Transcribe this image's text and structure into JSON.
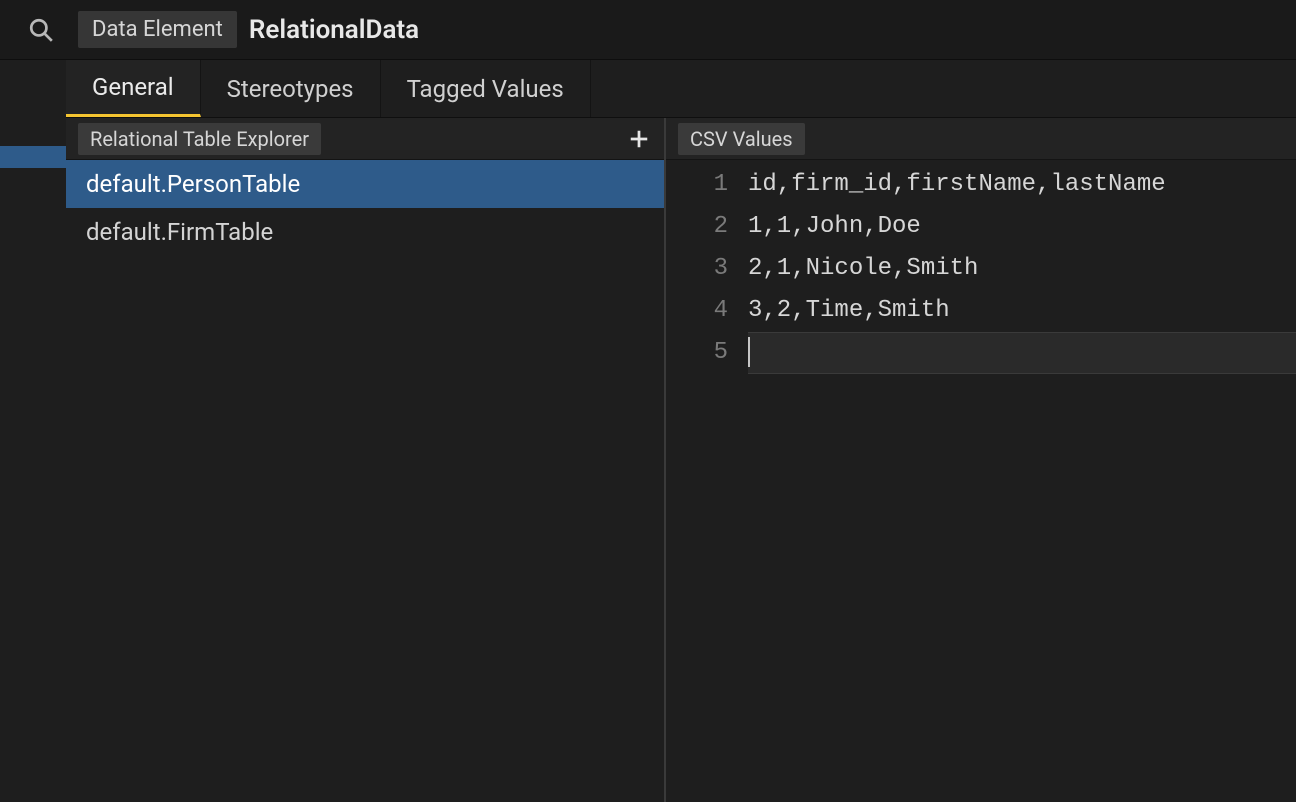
{
  "header": {
    "chip_label": "Data Element",
    "title": "RelationalData"
  },
  "tabs": [
    {
      "label": "General",
      "active": true
    },
    {
      "label": "Stereotypes",
      "active": false
    },
    {
      "label": "Tagged Values",
      "active": false
    }
  ],
  "explorer": {
    "header_label": "Relational Table Explorer",
    "items": [
      {
        "label": "default.PersonTable",
        "selected": true
      },
      {
        "label": "default.FirmTable",
        "selected": false
      }
    ]
  },
  "csv_panel": {
    "header_label": "CSV Values",
    "lines": [
      "id,firm_id,firstName,lastName",
      "1,1,John,Doe",
      "2,1,Nicole,Smith",
      "3,2,Time,Smith",
      ""
    ]
  },
  "icons": {
    "search": "search-icon",
    "plus": "plus-icon"
  }
}
